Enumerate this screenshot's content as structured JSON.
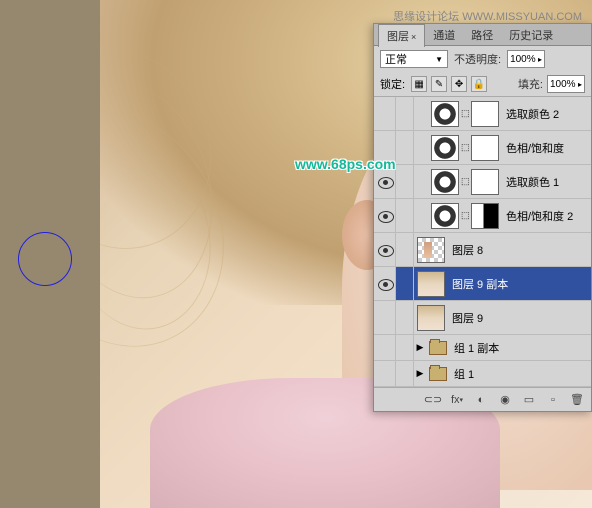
{
  "watermark": {
    "top": "思缘设计论坛 WWW.MISSYUAN.COM",
    "logo": "www.68ps.com"
  },
  "panel": {
    "tabs": {
      "layers": "图层",
      "channels": "通道",
      "paths": "路径",
      "history": "历史记录"
    },
    "blend_mode": "正常",
    "opacity_label": "不透明度:",
    "opacity_value": "100%",
    "lock_label": "锁定:",
    "fill_label": "填充:",
    "fill_value": "100%"
  },
  "layers": [
    {
      "name": "选取颜色 2",
      "type": "adjustment",
      "visible": false
    },
    {
      "name": "色相/饱和度",
      "type": "adjustment",
      "visible": false
    },
    {
      "name": "选取颜色 1",
      "type": "adjustment",
      "visible": true
    },
    {
      "name": "色相/饱和度 2",
      "type": "adjustment",
      "visible": true,
      "mask": "sil"
    },
    {
      "name": "图层 8",
      "type": "image",
      "visible": true,
      "transparent": true
    },
    {
      "name": "图层 9 副本",
      "type": "image",
      "visible": true,
      "selected": true
    },
    {
      "name": "图层 9",
      "type": "image",
      "visible": false
    },
    {
      "name": "组 1 副本",
      "type": "group",
      "visible": false
    },
    {
      "name": "组 1",
      "type": "group",
      "visible": false
    }
  ],
  "footer": {
    "link": "⊂⊃",
    "fx": "fx",
    "mask": "◐",
    "adj": "◉",
    "folder": "▭",
    "new": "▫",
    "trash": "🗑"
  }
}
